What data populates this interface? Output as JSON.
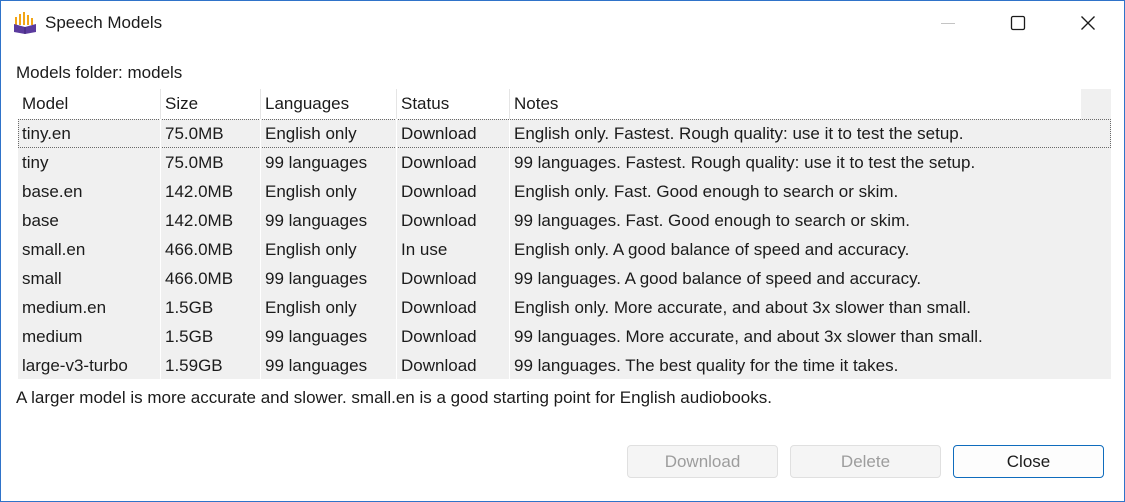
{
  "window": {
    "title": "Speech Models",
    "accent": "#0f6cbd",
    "controls": [
      "minimize-icon",
      "maximize-icon",
      "close-icon"
    ]
  },
  "folder": {
    "label": "Models folder: models"
  },
  "table": {
    "columns": [
      "Model",
      "Size",
      "Languages",
      "Status",
      "Notes"
    ],
    "rows": [
      {
        "model": "tiny.en",
        "size": "75.0MB",
        "languages": "English only",
        "status": "Download",
        "notes": "English only. Fastest. Rough quality: use it to test the setup."
      },
      {
        "model": "tiny",
        "size": "75.0MB",
        "languages": "99 languages",
        "status": "Download",
        "notes": "99 languages. Fastest. Rough quality: use it to test the setup."
      },
      {
        "model": "base.en",
        "size": "142.0MB",
        "languages": "English only",
        "status": "Download",
        "notes": "English only. Fast. Good enough to search or skim."
      },
      {
        "model": "base",
        "size": "142.0MB",
        "languages": "99 languages",
        "status": "Download",
        "notes": "99 languages. Fast. Good enough to search or skim."
      },
      {
        "model": "small.en",
        "size": "466.0MB",
        "languages": "English only",
        "status": "In use",
        "notes": "English only. A good balance of speed and accuracy."
      },
      {
        "model": "small",
        "size": "466.0MB",
        "languages": "99 languages",
        "status": "Download",
        "notes": "99 languages. A good balance of speed and accuracy."
      },
      {
        "model": "medium.en",
        "size": "1.5GB",
        "languages": "English only",
        "status": "Download",
        "notes": "English only. More accurate, and about 3x slower than small."
      },
      {
        "model": "medium",
        "size": "1.5GB",
        "languages": "99 languages",
        "status": "Download",
        "notes": "99 languages. More accurate, and about 3x slower than small."
      },
      {
        "model": "large-v3-turbo",
        "size": "1.59GB",
        "languages": "99 languages",
        "status": "Download",
        "notes": "99 languages. The best quality for the time it takes."
      }
    ]
  },
  "hint": "A larger model is more accurate and slower. small.en is a good starting point for English audiobooks.",
  "buttons": {
    "download": "Download",
    "delete": "Delete",
    "close": "Close"
  }
}
